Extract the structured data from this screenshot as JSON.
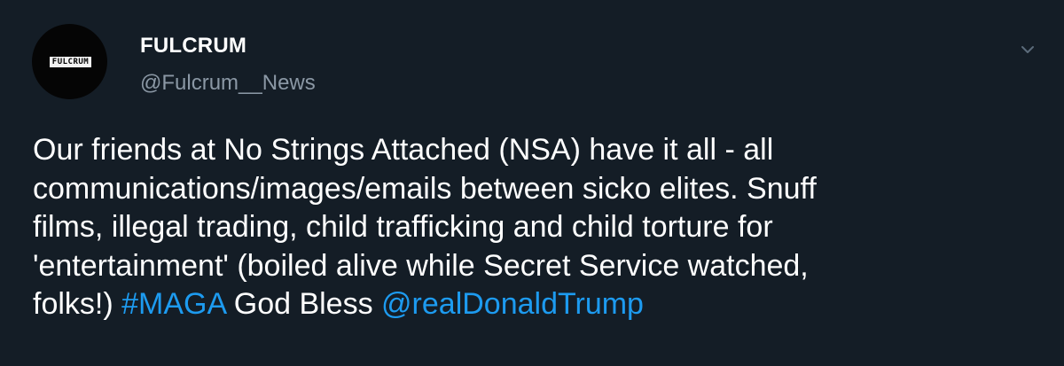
{
  "account": {
    "display_name": "FULCRUM",
    "handle": "@Fulcrum__News",
    "avatar_logo_text": "FULCRUM"
  },
  "tweet": {
    "line1": "Our friends at No Strings Attached (NSA) have it all - all",
    "line2": "communications/images/emails between sicko elites. Snuff",
    "line3": "films, illegal trading, child trafficking and child torture for",
    "line4": "'entertainment' (boiled alive while Secret Service watched,",
    "line5_start": "folks!) ",
    "hashtag": "#MAGA",
    "line5_middle": " God Bless ",
    "mention": "@realDonaldTrump"
  },
  "icons": {
    "menu": "chevron-down-icon"
  },
  "colors": {
    "background": "#141d26",
    "text": "#ffffff",
    "secondary_text": "#8b98a5",
    "link": "#1d9bf0"
  }
}
